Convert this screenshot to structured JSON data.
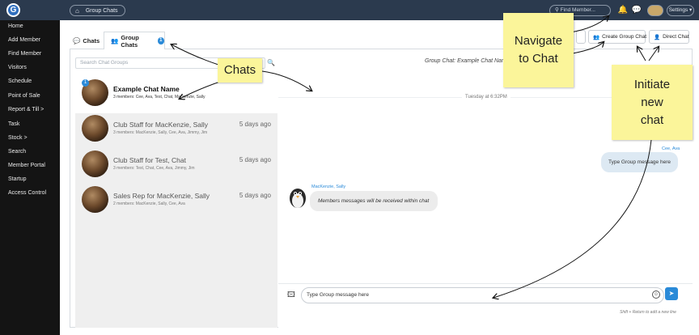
{
  "topbar": {
    "logo": "G",
    "breadcrumb": "Group Chats",
    "find_member_placeholder": "Find Member...",
    "settings_label": "Settings"
  },
  "sidebar": {
    "items": [
      {
        "label": "Home"
      },
      {
        "label": "Add Member"
      },
      {
        "label": "Find Member"
      },
      {
        "label": "Visitors"
      },
      {
        "label": "Schedule"
      },
      {
        "label": "Point of Sale"
      },
      {
        "label": "Report & Till >"
      },
      {
        "label": "Task"
      },
      {
        "label": "Stock >"
      },
      {
        "label": "Search"
      },
      {
        "label": "Member Portal"
      },
      {
        "label": "Startup"
      },
      {
        "label": "Access Control"
      }
    ]
  },
  "tabs": {
    "chats": "Chats",
    "group_chats": "Group Chats",
    "group_badge": "1"
  },
  "buttons": {
    "create_group_chat": "Create Group Chat",
    "direct_chat": "Direct Chat"
  },
  "search": {
    "placeholder": "Search Chat Groups"
  },
  "chat_list": [
    {
      "name": "Example Chat Name",
      "members": "3 members: Cee, Ava, Test, Chat, Mackenzie, Sally",
      "time": "",
      "unread": "1"
    },
    {
      "name": "Club Staff for MacKenzie, Sally",
      "members": "3 members: MacKenzie, Sally, Cee, Ava, Jimmy, Jim",
      "time": "5 days ago",
      "unread": ""
    },
    {
      "name": "Club Staff for Test, Chat",
      "members": "3 members: Test, Chat, Cee, Ava, Jimmy, Jim",
      "time": "5 days ago",
      "unread": ""
    },
    {
      "name": "Sales Rep for MacKenzie, Sally",
      "members": "2 members: MacKenzie, Sally, Cee, Ava",
      "time": "5 days ago",
      "unread": ""
    }
  ],
  "chat": {
    "title": "Group Chat: Example Chat Name",
    "date_separator": "Tuesday at 6:32PM",
    "messages": [
      {
        "sender": "Cee, Ava",
        "text": "Type Group message here",
        "side": "right"
      },
      {
        "sender": "MacKenzie, Sally",
        "text": "Members messages will be received within chat",
        "side": "left"
      }
    ],
    "input_value": "Type Group message here",
    "hint": "Shift + Return to add a new line"
  },
  "annotations": {
    "chats": "Chats",
    "navigate_line1": "Navigate",
    "navigate_line2": "to Chat",
    "initiate_line1": "Initiate",
    "initiate_line2": "new",
    "initiate_line3": "chat"
  },
  "colors": {
    "topbar": "#2b3a4e",
    "sidebar": "#141414",
    "accent": "#2a8ad8",
    "note": "#fbf59a"
  }
}
